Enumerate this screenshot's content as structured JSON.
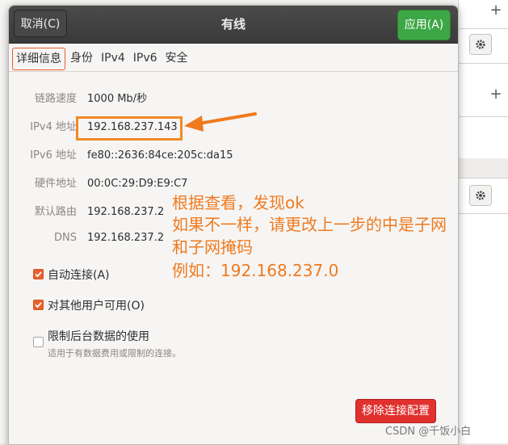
{
  "dialog": {
    "title": "有线",
    "cancel_label": "取消(C)",
    "apply_label": "应用(A)"
  },
  "tabs": [
    {
      "label": "详细信息",
      "active": true
    },
    {
      "label": "身份",
      "active": false
    },
    {
      "label": "IPv4",
      "active": false
    },
    {
      "label": "IPv6",
      "active": false
    },
    {
      "label": "安全",
      "active": false
    }
  ],
  "details": [
    {
      "label": "链路速度",
      "value": "1000 Mb/秒"
    },
    {
      "label": "IPv4 地址",
      "value": "192.168.237.143"
    },
    {
      "label": "IPv6 地址",
      "value": "fe80::2636:84ce:205c:da15"
    },
    {
      "label": "硬件地址",
      "value": "00:0C:29:D9:E9:C7"
    },
    {
      "label": "默认路由",
      "value": "192.168.237.2"
    },
    {
      "label": "DNS",
      "value": "192.168.237.2"
    }
  ],
  "options": {
    "auto_connect": {
      "label": "自动连接(A)",
      "checked": true
    },
    "all_users": {
      "label": "对其他用户可用(O)",
      "checked": true
    },
    "metered": {
      "label": "限制后台数据的使用",
      "sublabel": "适用于有数据费用或限制的连接。",
      "checked": false
    }
  },
  "remove_label": "移除连接配置",
  "annotation": {
    "line1": "根据查看，发现ok",
    "line2": "如果不一样，请更改上一步的中是子网",
    "line3": "和子网掩码",
    "line4": "例如：192.168.237.0",
    "color": "#f07a1e"
  },
  "watermark": "CSDN @千饭小白",
  "colors": {
    "apply": "#3da745",
    "remove": "#e0312f",
    "accent": "#e8622f"
  }
}
